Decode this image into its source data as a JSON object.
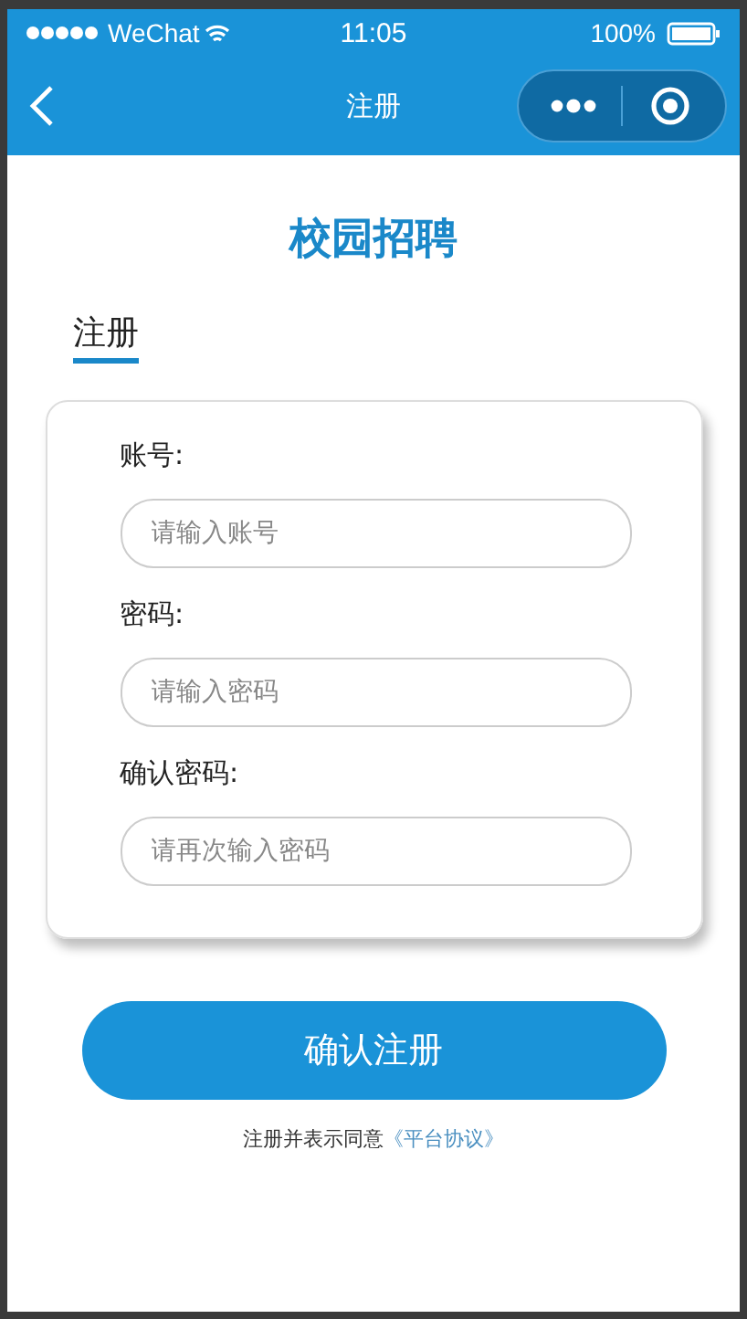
{
  "status_bar": {
    "carrier": "WeChat",
    "time": "11:05",
    "battery": "100%"
  },
  "nav": {
    "title": "注册"
  },
  "heading": "校园招聘",
  "tabs": [
    {
      "label": "注册",
      "selected": true
    }
  ],
  "form": {
    "fields": [
      {
        "label": "账号:",
        "placeholder": "请输入账号"
      },
      {
        "label": "密码:",
        "placeholder": "请输入密码"
      },
      {
        "label": "确认密码:",
        "placeholder": "请再次输入密码"
      }
    ]
  },
  "submit": "确认注册",
  "agreement": {
    "text": "注册并表示同意",
    "link": "《平台协议》"
  }
}
